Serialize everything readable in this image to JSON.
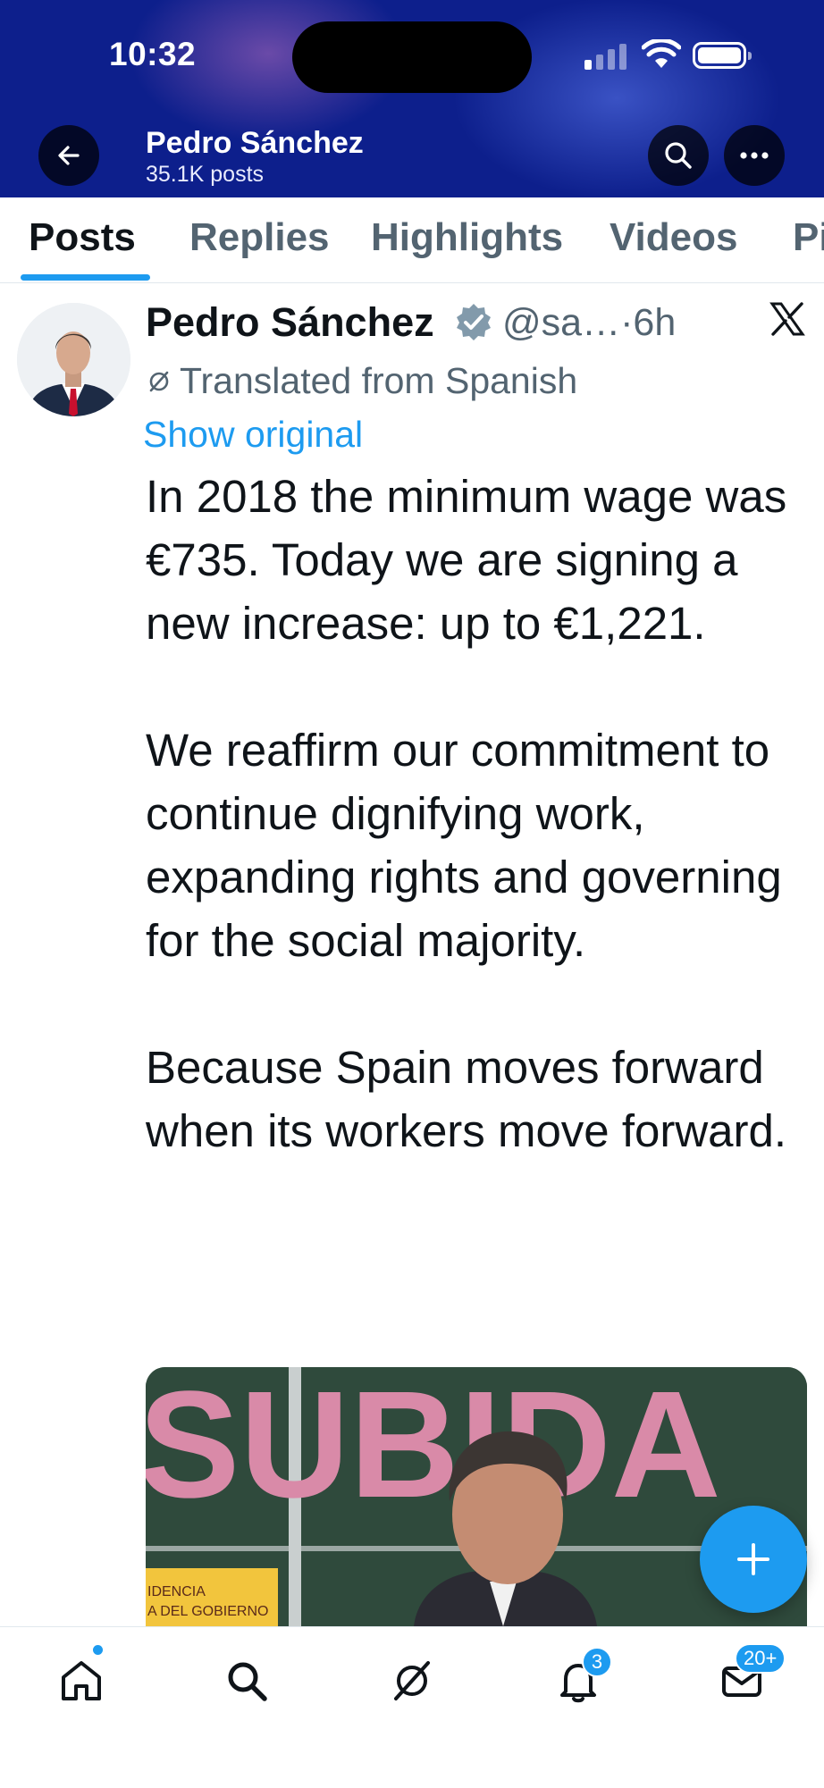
{
  "status_bar": {
    "time": "10:32"
  },
  "header": {
    "profile_name": "Pedro Sánchez",
    "post_count": "35.1K posts",
    "back_icon": "arrow-left-icon",
    "search_icon": "search-icon",
    "more_icon": "ellipsis-icon"
  },
  "tabs": [
    {
      "label": "Posts",
      "active": true
    },
    {
      "label": "Replies",
      "active": false
    },
    {
      "label": "Highlights",
      "active": false
    },
    {
      "label": "Videos",
      "active": false
    },
    {
      "label": "Pi",
      "active": false
    }
  ],
  "tweet": {
    "author": "Pedro Sánchez",
    "handle": "@sa…",
    "separator": "·",
    "time": "6h",
    "translated_label": "Translated from Spanish",
    "show_original": "Show original",
    "body": [
      "In 2018 the minimum wage was €735. Today we are signing a new increase: up to €1,221.",
      "We reaffirm our commitment to continue dignifying work, expanding rights and governing for the social majority.",
      "Because Spain moves forward when its workers move forward."
    ],
    "media": {
      "banner_text": "SUBIDA",
      "sign_line1": "IDENCIA",
      "sign_line2": "A DEL GOBIERNO"
    }
  },
  "bottom_nav": {
    "notifications_badge": "3",
    "messages_badge": "20+"
  },
  "colors": {
    "accent": "#1d9bf0",
    "header_bg": "#0d1f8c",
    "text_primary": "#0f1419",
    "text_secondary": "#536471"
  }
}
